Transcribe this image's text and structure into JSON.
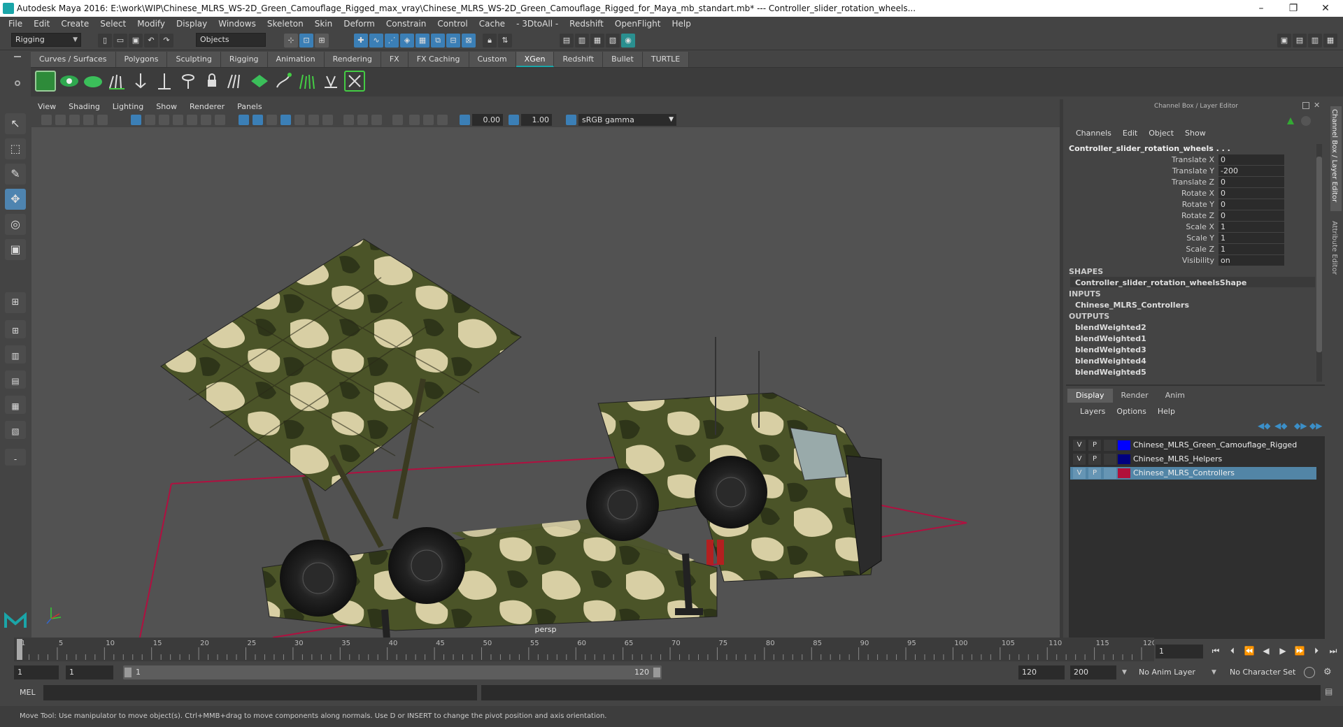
{
  "window": {
    "title": "Autodesk Maya 2016: E:\\work\\WIP\\Chinese_MLRS_WS-2D_Green_Camouflage_Rigged_max_vray\\Chinese_MLRS_WS-2D_Green_Camouflage_Rigged_for_Maya_mb_standart.mb*   ---   Controller_slider_rotation_wheels...",
    "minimize": "–",
    "maximize": "❐",
    "close": "✕"
  },
  "menubar": [
    "File",
    "Edit",
    "Create",
    "Select",
    "Modify",
    "Display",
    "Windows",
    "Skeleton",
    "Skin",
    "Deform",
    "Constrain",
    "Control",
    "Cache",
    "- 3DtoAll -",
    "Redshift",
    "OpenFlight",
    "Help"
  ],
  "status_line": {
    "mode": "Rigging",
    "selection_mask": "Objects"
  },
  "shelf_tabs": [
    "Curves / Surfaces",
    "Polygons",
    "Sculpting",
    "Rigging",
    "Animation",
    "Rendering",
    "FX",
    "FX Caching",
    "Custom",
    "XGen",
    "Redshift",
    "Bullet",
    "TURTLE"
  ],
  "active_shelf_tab": "XGen",
  "viewport": {
    "menu": [
      "View",
      "Shading",
      "Lighting",
      "Show",
      "Renderer",
      "Panels"
    ],
    "exposure": "0.00",
    "gamma": "1.00",
    "color_space": "sRGB gamma",
    "camera": "persp"
  },
  "channel_box": {
    "header": "Channel Box / Layer Editor",
    "menu": [
      "Channels",
      "Edit",
      "Object",
      "Show"
    ],
    "object_name": "Controller_slider_rotation_wheels . . .",
    "channels": [
      {
        "label": "Translate X",
        "value": "0"
      },
      {
        "label": "Translate Y",
        "value": "-200"
      },
      {
        "label": "Translate Z",
        "value": "0"
      },
      {
        "label": "Rotate X",
        "value": "0"
      },
      {
        "label": "Rotate Y",
        "value": "0"
      },
      {
        "label": "Rotate Z",
        "value": "0"
      },
      {
        "label": "Scale X",
        "value": "1"
      },
      {
        "label": "Scale Y",
        "value": "1"
      },
      {
        "label": "Scale Z",
        "value": "1"
      },
      {
        "label": "Visibility",
        "value": "on"
      }
    ],
    "shapes_label": "SHAPES",
    "shape": "Controller_slider_rotation_wheelsShape",
    "inputs_label": "INPUTS",
    "input": "Chinese_MLRS_Controllers",
    "outputs_label": "OUTPUTS",
    "outputs": [
      "blendWeighted2",
      "blendWeighted1",
      "blendWeighted3",
      "blendWeighted4",
      "blendWeighted5"
    ]
  },
  "layer_editor": {
    "tabs": [
      "Display",
      "Render",
      "Anim"
    ],
    "active_tab": "Display",
    "menu": [
      "Layers",
      "Options",
      "Help"
    ],
    "layers": [
      {
        "v": "V",
        "p": "P",
        "name": "Chinese_MLRS_Green_Camouflage_Rigged",
        "color": "#0000ff",
        "selected": false
      },
      {
        "v": "V",
        "p": "P",
        "name": "Chinese_MLRS_Helpers",
        "color": "#000080",
        "selected": false
      },
      {
        "v": "V",
        "p": "P",
        "name": "Chinese_MLRS_Controllers",
        "color": "#b0103a",
        "selected": true
      }
    ]
  },
  "side_tabs": [
    "Channel Box / Layer Editor",
    "Attribute Editor"
  ],
  "timeline": {
    "ticks": [
      "1",
      "5",
      "10",
      "15",
      "20",
      "25",
      "30",
      "35",
      "40",
      "45",
      "50",
      "55",
      "60",
      "65",
      "70",
      "75",
      "80",
      "85",
      "90",
      "95",
      "100",
      "105",
      "110",
      "115",
      "120"
    ],
    "current_frame": "1"
  },
  "range": {
    "start": "1",
    "playback_start": "1",
    "slider_start": "1",
    "slider_end": "120",
    "playback_end": "120",
    "end": "200",
    "anim_layer": "No Anim Layer",
    "character_set": "No Character Set"
  },
  "mel_label": "MEL",
  "help_line": "Move Tool: Use manipulator to move object(s). Ctrl+MMB+drag to move components along normals. Use D or INSERT to change the pivot position and axis orientation.",
  "colors": {
    "accent": "#1aa5a8",
    "selection": "#5285a6",
    "tool_active": "#4e84b0"
  }
}
